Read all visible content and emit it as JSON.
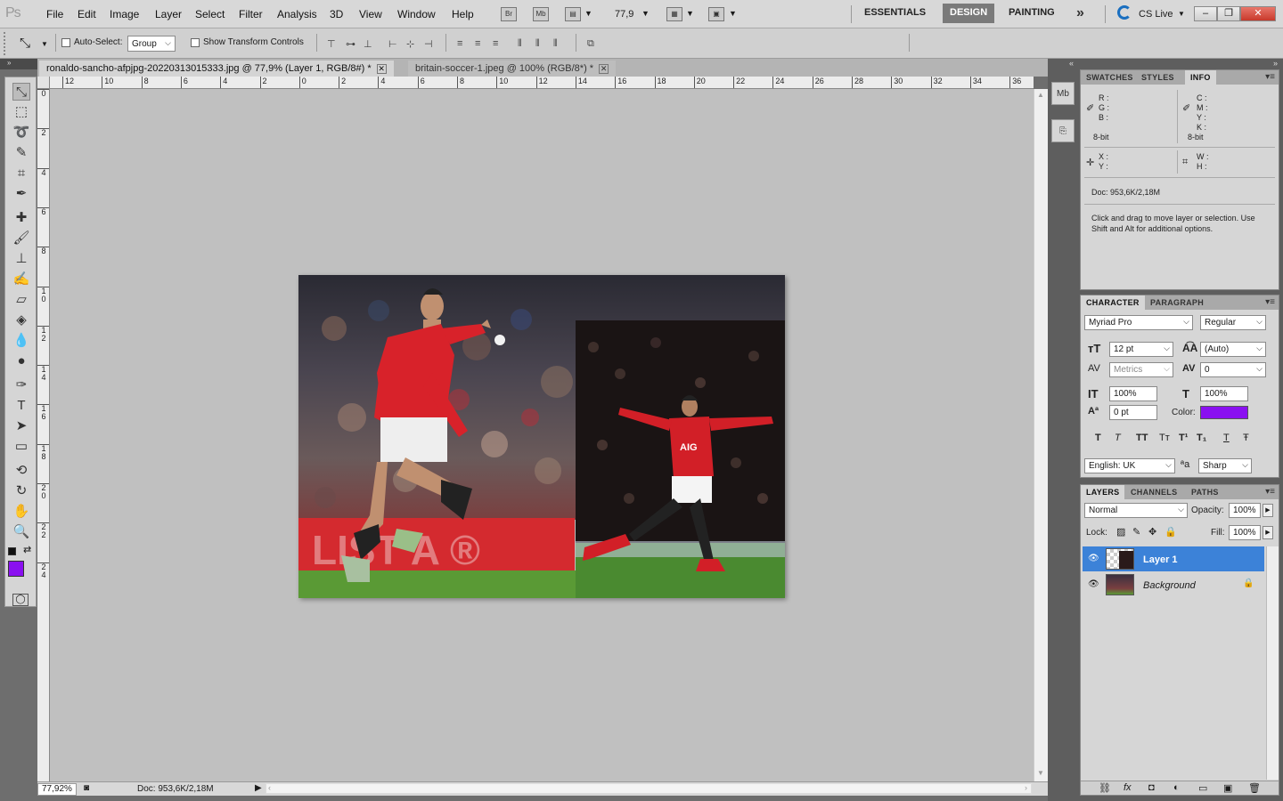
{
  "app": {
    "logo": "Ps"
  },
  "menu": [
    "File",
    "Edit",
    "Image",
    "Layer",
    "Select",
    "Filter",
    "Analysis",
    "3D",
    "View",
    "Window",
    "Help"
  ],
  "top_controls": {
    "bridge": "Br",
    "minibridge": "Mb",
    "zoom": "77,9"
  },
  "workspaces": [
    "ESSENTIALS",
    "DESIGN",
    "PAINTING"
  ],
  "active_workspace": "DESIGN",
  "more": "»",
  "cslive": "CS Live",
  "options": {
    "auto_select_label": "Auto-Select:",
    "auto_select_value": "Group",
    "show_transform_label": "Show Transform Controls"
  },
  "tabs": [
    {
      "label": "ronaldo-sancho-afpjpg-20220313015333.jpg @ 77,9% (Layer 1, RGB/8#) *",
      "active": true
    },
    {
      "label": "britain-soccer-1.jpeg @ 100% (RGB/8*) *",
      "active": false
    }
  ],
  "ruler_h": [
    "12",
    "10",
    "8",
    "6",
    "4",
    "2",
    "0",
    "2",
    "4",
    "6",
    "8",
    "10",
    "12",
    "14",
    "16",
    "18",
    "20",
    "22",
    "24",
    "26",
    "28",
    "30",
    "32",
    "34",
    "36"
  ],
  "ruler_v": [
    "0",
    "2",
    "4",
    "6",
    "8",
    "10",
    "12",
    "14",
    "16",
    "18",
    "20",
    "22",
    "24"
  ],
  "status": {
    "zoom": "77,92%",
    "doc": "Doc: 953,6K/2,18M"
  },
  "info_panel": {
    "tabs": [
      "SWATCHES",
      "STYLES",
      "INFO"
    ],
    "active": "INFO",
    "rgb": [
      "R :",
      "G :",
      "B :"
    ],
    "cmyk": [
      "C :",
      "M :",
      "Y :",
      "K :"
    ],
    "bit_left": "8-bit",
    "bit_right": "8-bit",
    "xy": [
      "X :",
      "Y :"
    ],
    "wh": [
      "W :",
      "H :"
    ],
    "doc": "Doc: 953,6K/2,18M",
    "hint": "Click and drag to move layer or selection. Use Shift and Alt for additional options."
  },
  "character_panel": {
    "tabs": [
      "CHARACTER",
      "PARAGRAPH"
    ],
    "font": "Myriad Pro",
    "style": "Regular",
    "size": "12 pt",
    "leading": "(Auto)",
    "kerning": "Metrics",
    "tracking": "0",
    "vscale": "100%",
    "hscale": "100%",
    "baseline": "0 pt",
    "color_label": "Color:",
    "color": "#8a10f0",
    "language": "English: UK",
    "aa_label": "a",
    "antialias": "Sharp",
    "styles": [
      "T",
      "T",
      "TT",
      "Tт",
      "T¹",
      "T₁",
      "T",
      "Ŧ"
    ]
  },
  "layers_panel": {
    "tabs": [
      "LAYERS",
      "CHANNELS",
      "PATHS"
    ],
    "blend": "Normal",
    "opacity_label": "Opacity:",
    "opacity": "100%",
    "lock_label": "Lock:",
    "fill_label": "Fill:",
    "fill": "100%",
    "layers": [
      {
        "name": "Layer 1",
        "selected": true
      },
      {
        "name": "Background",
        "selected": false
      }
    ]
  },
  "colors": {
    "foreground": "#8a10f0",
    "background": "#b7d98a",
    "selection": "#3c82d8"
  }
}
